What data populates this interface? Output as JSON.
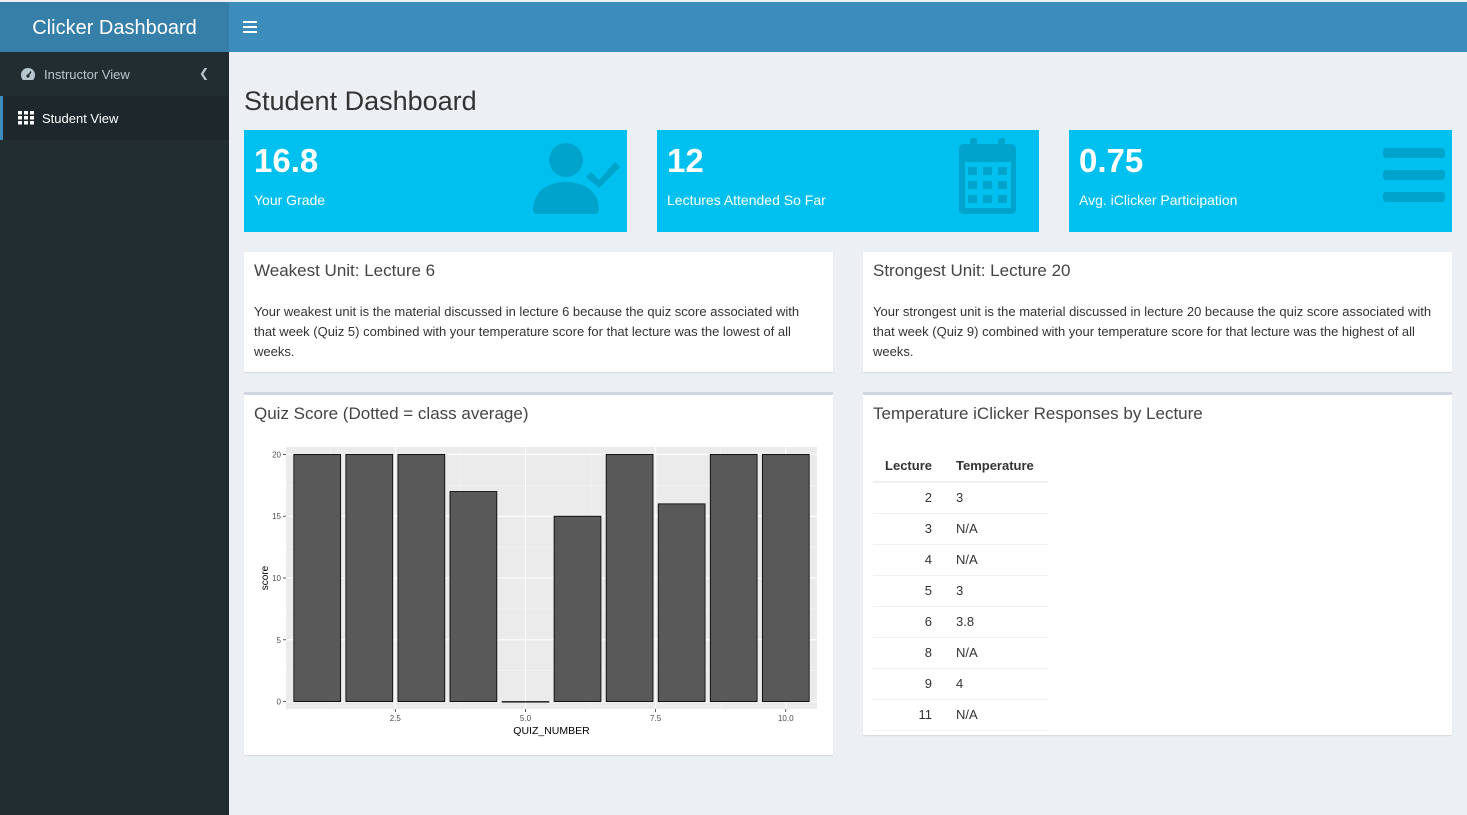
{
  "app": {
    "title": "Clicker Dashboard"
  },
  "sidebar": {
    "items": [
      {
        "label": "Instructor View",
        "icon": "dashboard-icon",
        "active": false
      },
      {
        "label": "Student View",
        "icon": "grid-icon",
        "active": true
      }
    ]
  },
  "page": {
    "title": "Student Dashboard"
  },
  "info_boxes": [
    {
      "value": "16.8",
      "label": "Your Grade",
      "icon": "user-check-icon"
    },
    {
      "value": "12",
      "label": "Lectures Attended So Far",
      "icon": "calendar-icon"
    },
    {
      "value": "0.75",
      "label": "Avg. iClicker Participation",
      "icon": "list-lines-icon"
    }
  ],
  "weakest": {
    "title": "Weakest Unit: Lecture 6",
    "body": "Your weakest unit is the material discussed in lecture 6 because the quiz score associated with that week (Quiz 5) combined with your temperature score for that lecture was the lowest of all weeks."
  },
  "strongest": {
    "title": "Strongest Unit: Lecture 20",
    "body": "Your strongest unit is the material discussed in lecture 20 because the quiz score associated with that week (Quiz 9) combined with your temperature score for that lecture was the highest of all weeks."
  },
  "quiz_box": {
    "title": "Quiz Score (Dotted = class average)"
  },
  "temperature_box": {
    "title": "Temperature iClicker Responses by Lecture",
    "columns": [
      "Lecture",
      "Temperature"
    ],
    "rows": [
      [
        "2",
        "3"
      ],
      [
        "3",
        "N/A"
      ],
      [
        "4",
        "N/A"
      ],
      [
        "5",
        "3"
      ],
      [
        "6",
        "3.8"
      ],
      [
        "8",
        "N/A"
      ],
      [
        "9",
        "4"
      ],
      [
        "11",
        "N/A"
      ]
    ]
  },
  "colors": {
    "info": "#00c0ef",
    "header": "#3c8dbc",
    "sidebar": "#222d32",
    "bar_fill": "#595959",
    "panel_bg": "#ebebeb"
  },
  "chart_data": {
    "type": "bar",
    "x": [
      1,
      2,
      3,
      4,
      5,
      6,
      7,
      8,
      9,
      10
    ],
    "values": [
      20,
      20,
      20,
      17,
      0,
      15,
      20,
      16,
      20,
      20
    ],
    "xlabel": "QUIZ_NUMBER",
    "ylabel": "score",
    "xticks": [
      "2.5",
      "5.0",
      "7.5",
      "10.0"
    ],
    "yticks": [
      "0",
      "5",
      "10",
      "15",
      "20"
    ],
    "xlim": [
      0.4,
      10.6
    ],
    "ylim": [
      -0.6,
      20.6
    ],
    "grid": true
  }
}
